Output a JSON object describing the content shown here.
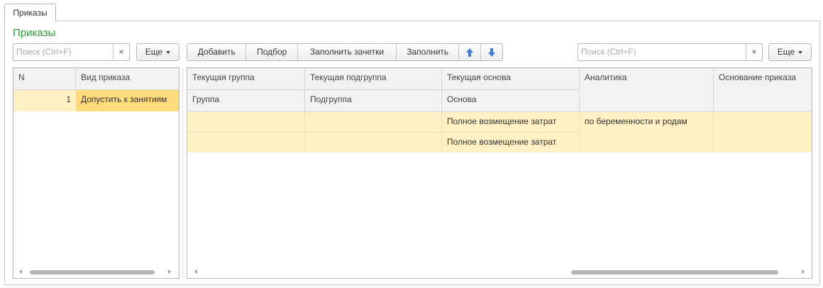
{
  "tab": {
    "label": "Приказы"
  },
  "form": {
    "title": "Приказы"
  },
  "left": {
    "search_placeholder": "Поиск (Ctrl+F)",
    "clear_glyph": "×",
    "more_label": "Еще",
    "columns": [
      "N",
      "Вид приказа"
    ],
    "rows": [
      {
        "n": "1",
        "kind": "Допустить к занятиям"
      }
    ]
  },
  "toolbar": {
    "add_label": "Добавить",
    "pick_label": "Подбор",
    "fill_records_label": "Заполнить зачетки",
    "fill_label": "Заполнить"
  },
  "right": {
    "search_placeholder": "Поиск (Ctrl+F)",
    "clear_glyph": "×",
    "more_label": "Еще",
    "header_row1": [
      "Текущая группа",
      "Текущая подгруппа",
      "Текущая основа",
      "Аналитика",
      "Основание приказа"
    ],
    "header_row2": [
      "Группа",
      "Подгруппа",
      "Основа"
    ],
    "rows": [
      {
        "basis": "Полное возмещение затрат",
        "analytics": "по беременности и родам"
      },
      {
        "basis": "Полное возмещение затрат"
      }
    ]
  },
  "colors": {
    "title": "#2a9d3a",
    "selection": "#fff1c4",
    "selection_active": "#ffdb7b",
    "arrow": "#3b7fd4"
  }
}
